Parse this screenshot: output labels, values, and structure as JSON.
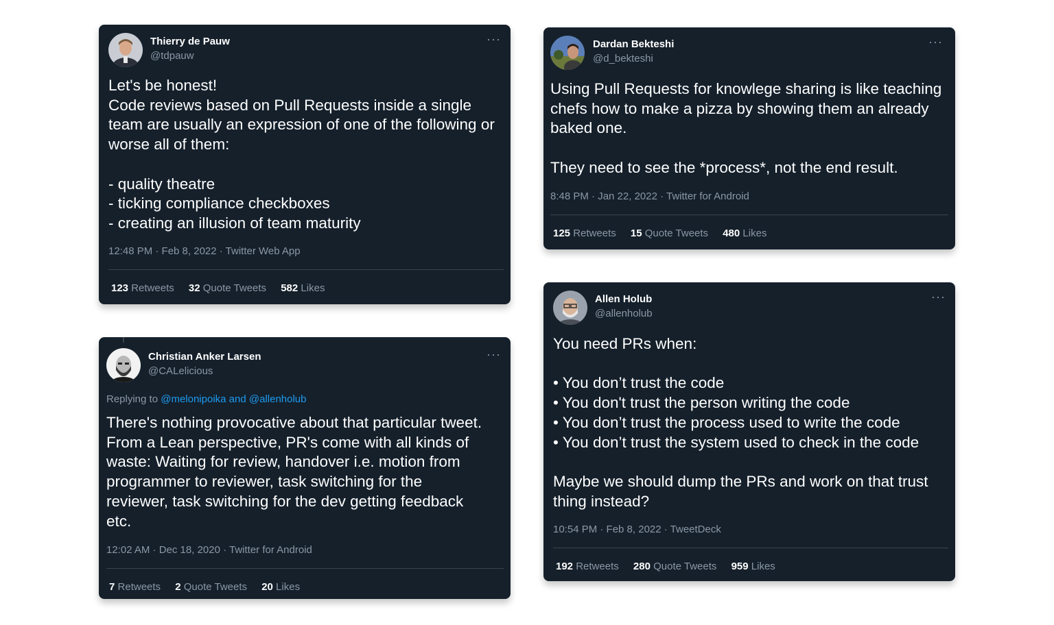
{
  "colors": {
    "page_background": "#ffffff",
    "card_background": "#15202b",
    "text_primary": "#ffffff",
    "text_secondary": "#8b98a5",
    "link": "#1d9bf0",
    "divider": "#38444d"
  },
  "tweets": [
    {
      "name": "Thierry de Pauw",
      "handle": "@tdpauw",
      "more_icon": "more-horizontal-icon",
      "body": "Let's be honest!\nCode reviews based on Pull Requests inside a single team are usually an expression of one of the following or worse all of them:\n\n- quality theatre\n- ticking compliance checkboxes\n- creating an illusion of team maturity",
      "meta": "12:48 PM · Feb 8, 2022 · Twitter Web App",
      "retweets": "123",
      "retweets_label": "Retweets",
      "quotes": "32",
      "quotes_label": "Quote Tweets",
      "likes": "582",
      "likes_label": "Likes"
    },
    {
      "name": "Dardan Bekteshi",
      "handle": "@d_bekteshi",
      "more_icon": "more-horizontal-icon",
      "body": "Using Pull Requests for knowlege sharing is like teaching chefs how to make a pizza by showing them an already baked one.\n\nThey need to see the *process*, not the end result.",
      "meta": "8:48 PM · Jan 22, 2022 · Twitter for Android",
      "retweets": "125",
      "retweets_label": "Retweets",
      "quotes": "15",
      "quotes_label": "Quote Tweets",
      "likes": "480",
      "likes_label": "Likes"
    },
    {
      "name": "Christian Anker Larsen",
      "handle": "@CALelicious",
      "more_icon": "more-horizontal-icon",
      "reply_prefix": "Replying to",
      "reply_user_1": "@melonipoika",
      "reply_and": "and",
      "reply_user_2": "@allenholub",
      "body": "There's nothing provocative about that particular tweet. From a Lean perspective, PR's come with all kinds of waste: Waiting for review, handover i.e. motion from programmer to reviewer, task switching for the reviewer, task switching for the dev getting feedback etc.",
      "meta": "12:02 AM · Dec 18, 2020 · Twitter for Android",
      "retweets": "7",
      "retweets_label": "Retweets",
      "quotes": "2",
      "quotes_label": "Quote Tweets",
      "likes": "20",
      "likes_label": "Likes"
    },
    {
      "name": "Allen Holub",
      "handle": "@allenholub",
      "more_icon": "more-horizontal-icon",
      "body": "You need PRs when:\n\n• You don’t trust the code\n• You don't trust the person writing the code\n• You don’t trust the process used to write the code\n• You don’t trust the system used to check in the code\n\nMaybe we should dump the PRs and work on that trust thing instead?",
      "meta": "10:54 PM · Feb 8, 2022 · TweetDeck",
      "retweets": "192",
      "retweets_label": "Retweets",
      "quotes": "280",
      "quotes_label": "Quote Tweets",
      "likes": "959",
      "likes_label": "Likes"
    }
  ]
}
